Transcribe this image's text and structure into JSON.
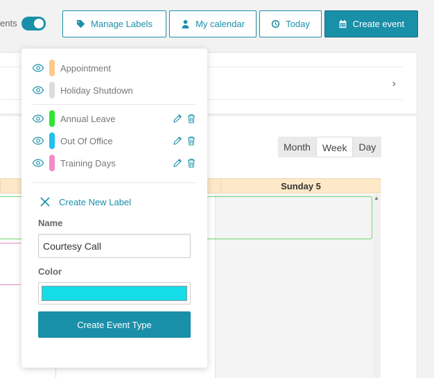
{
  "toolbar": {
    "events_label": "ents",
    "manage_labels": "Manage Labels",
    "my_calendar": "My calendar",
    "today": "Today",
    "create_event": "Create event",
    "accent": "#1a8fa8"
  },
  "views": [
    "Month",
    "Week",
    "Day"
  ],
  "active_view": "Week",
  "calendar": {
    "day_header": "Sunday 5"
  },
  "labels_popover": {
    "system_labels": [
      {
        "name": "Appointment",
        "color": "#fcc987",
        "icon": "eye-icon"
      },
      {
        "name": "Holiday Shutdown",
        "color": "#dcdcdc",
        "icon": "eye-icon"
      }
    ],
    "custom_labels": [
      {
        "name": "Annual Leave",
        "color": "#2ee62e",
        "icon": "eye-icon"
      },
      {
        "name": "Out Of Office",
        "color": "#1fc1ee",
        "icon": "eye-icon"
      },
      {
        "name": "Training Days",
        "color": "#f08cc8",
        "icon": "eye-icon"
      }
    ],
    "create_new_label": "Create New Label",
    "name_title": "Name",
    "name_value": "Courtesy Call",
    "color_title": "Color",
    "color_value": "#16dce8",
    "submit": "Create Event Type"
  }
}
